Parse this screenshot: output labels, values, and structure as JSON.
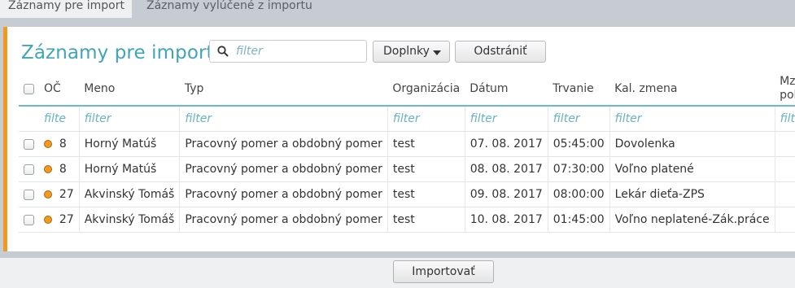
{
  "tabs": {
    "active": "Záznamy pre import",
    "inactive": "Záznamy vylúčené z importu"
  },
  "panel": {
    "title": "Záznamy pre import",
    "search_placeholder": "filter",
    "btn_doplnky": "Doplnky",
    "btn_odstranit": "Odstrániť"
  },
  "table": {
    "headers": {
      "oc": "OČ",
      "meno": "Meno",
      "typ": "Typ",
      "organizacia": "Organizácia",
      "datum": "Dátum",
      "trvanie": "Trvanie",
      "kal_zmena": "Kal. zmena",
      "mzd_polozka_1": "Mzd.",
      "mzd_polozka_2": "položka"
    },
    "filters": {
      "oc": "filte",
      "meno": "filter",
      "typ": "filter",
      "organizacia": "filter",
      "datum": "filter",
      "trvanie": "filter",
      "kal_zmena": "filter",
      "mzd_polozka": "filter"
    },
    "rows": [
      {
        "oc": "8",
        "meno": "Horný Matúš",
        "typ": "Pracovný pomer a obdobný pomer",
        "organizacia": "test",
        "datum": "07. 08. 2017",
        "trvanie": "05:45:00",
        "kal_zmena": "Dovolenka",
        "mzd_polozka": ""
      },
      {
        "oc": "8",
        "meno": "Horný Matúš",
        "typ": "Pracovný pomer a obdobný pomer",
        "organizacia": "test",
        "datum": "08. 08. 2017",
        "trvanie": "07:30:00",
        "kal_zmena": "Voľno platené",
        "mzd_polozka": ""
      },
      {
        "oc": "27",
        "meno": "Akvinský Tomáš",
        "typ": "Pracovný pomer a obdobný pomer",
        "organizacia": "test",
        "datum": "09. 08. 2017",
        "trvanie": "08:00:00",
        "kal_zmena": "Lekár dieťa-ZPS",
        "mzd_polozka": ""
      },
      {
        "oc": "27",
        "meno": "Akvinský Tomáš",
        "typ": "Pracovný pomer a obdobný pomer",
        "organizacia": "test",
        "datum": "10. 08. 2017",
        "trvanie": "01:45:00",
        "kal_zmena": "Voľno neplatené-Zák.práce",
        "mzd_polozka": ""
      }
    ]
  },
  "footer": {
    "import_button": "Importovať"
  },
  "colors": {
    "accent": "#f39a1e",
    "title": "#3fa5b8",
    "filter_text": "#66b3c4",
    "background": "#c7ccd3"
  },
  "icons": {
    "search": "search-icon",
    "caret": "chevron-down-icon",
    "status": "status-dot-icon"
  }
}
